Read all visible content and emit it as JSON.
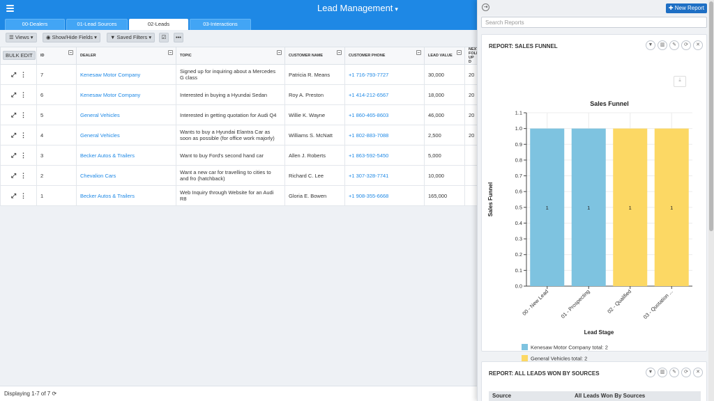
{
  "app": {
    "title": "Lead Management"
  },
  "tabs": [
    {
      "label": "00-Dealers",
      "active": false
    },
    {
      "label": "01-Lead Sources",
      "active": false
    },
    {
      "label": "02-Leads",
      "active": true
    },
    {
      "label": "03-Interactions",
      "active": false
    }
  ],
  "toolbar": {
    "views_label": "Views",
    "show_hide_label": "Show/Hide Fields",
    "saved_filters_label": "Saved Filters"
  },
  "grid": {
    "bulk_edit_label": "Bulk Edit",
    "columns": [
      "ID",
      "DEALER",
      "TOPIC",
      "CUSTOMER NAME",
      "CUSTOMER PHONE",
      "LEAD VALUE",
      "NEXT FOLLOW UP D"
    ],
    "rows": [
      {
        "id": "7",
        "dealer": "Kenesaw Motor Company",
        "topic": "Signed up for inquiring about a Mercedes G class",
        "customer": "Patricia R. Means",
        "phone": "+1 716-793-7727",
        "value": "30,000",
        "next": "20"
      },
      {
        "id": "6",
        "dealer": "Kenesaw Motor Company",
        "topic": "Interested in buying a Hyundai Sedan",
        "customer": "Roy A. Preston",
        "phone": "+1 414-212-6567",
        "value": "18,000",
        "next": "20"
      },
      {
        "id": "5",
        "dealer": "General Vehicles",
        "topic": "Interested in getting quotation for Audi Q4",
        "customer": "Willie K. Wayne",
        "phone": "+1 860-465-8603",
        "value": "46,000",
        "next": "20"
      },
      {
        "id": "4",
        "dealer": "General Vehicles",
        "topic": "Wants to buy a Hyundai Elantra Car as soon as possible (for office work majorly)",
        "customer": "Williams S. McNatt",
        "phone": "+1 802-883-7088",
        "value": "2,500",
        "next": "20"
      },
      {
        "id": "3",
        "dealer": "Becker Autos & Trailers",
        "topic": "Want to buy Ford's second hand car",
        "customer": "Allen J. Roberts",
        "phone": "+1 863-592-5450",
        "value": "5,000",
        "next": ""
      },
      {
        "id": "2",
        "dealer": "Chevalion Cars",
        "topic": "Want a new car for travelling to cities to and fro (hatchback)",
        "customer": "Richard C. Lee",
        "phone": "+1 307-328-7741",
        "value": "10,000",
        "next": ""
      },
      {
        "id": "1",
        "dealer": "Becker Autos & Trailers",
        "topic": "Web Inquiry through Website for an Audi R8",
        "customer": "Gloria E. Bowen",
        "phone": "+1 908-355-6668",
        "value": "165,000",
        "next": ""
      }
    ]
  },
  "status": {
    "text": "Displaying 1-7 of 7"
  },
  "panel": {
    "new_report_label": "New Report",
    "search_placeholder": "Search Reports",
    "report1_title": "REPORT: SALES FUNNEL",
    "report2_title": "REPORT: ALL LEADS WON BY SOURCES",
    "report2_columns": [
      "Source",
      "All Leads Won By Sources"
    ]
  },
  "colors": {
    "primary": "#1e88e5",
    "series_kenesaw": "#7ec3e0",
    "series_general": "#fcd864"
  },
  "chart_data": {
    "type": "bar",
    "title": "Sales Funnel",
    "xlabel": "Lead Stage",
    "ylabel": "Sales Funnel",
    "ylim": [
      0,
      1.1
    ],
    "yticks": [
      0.0,
      0.1,
      0.2,
      0.3,
      0.4,
      0.5,
      0.6,
      0.7,
      0.8,
      0.9,
      1.0,
      1.1
    ],
    "categories": [
      "00 - New Lead",
      "01 - Prospecting",
      "02 - Qualified",
      "03 - Quotation ..."
    ],
    "values": [
      1,
      1,
      1,
      1
    ],
    "bar_series": [
      "Kenesaw Motor Company",
      "Kenesaw Motor Company",
      "General Vehicles",
      "General Vehicles"
    ],
    "legend": [
      {
        "name": "Kenesaw Motor Company",
        "label": "Kenesaw Motor Company total: 2",
        "color": "#7ec3e0"
      },
      {
        "name": "General Vehicles",
        "label": "General Vehicles total: 2",
        "color": "#fcd864"
      }
    ],
    "legend_position": "bottom-left",
    "grid": true
  }
}
